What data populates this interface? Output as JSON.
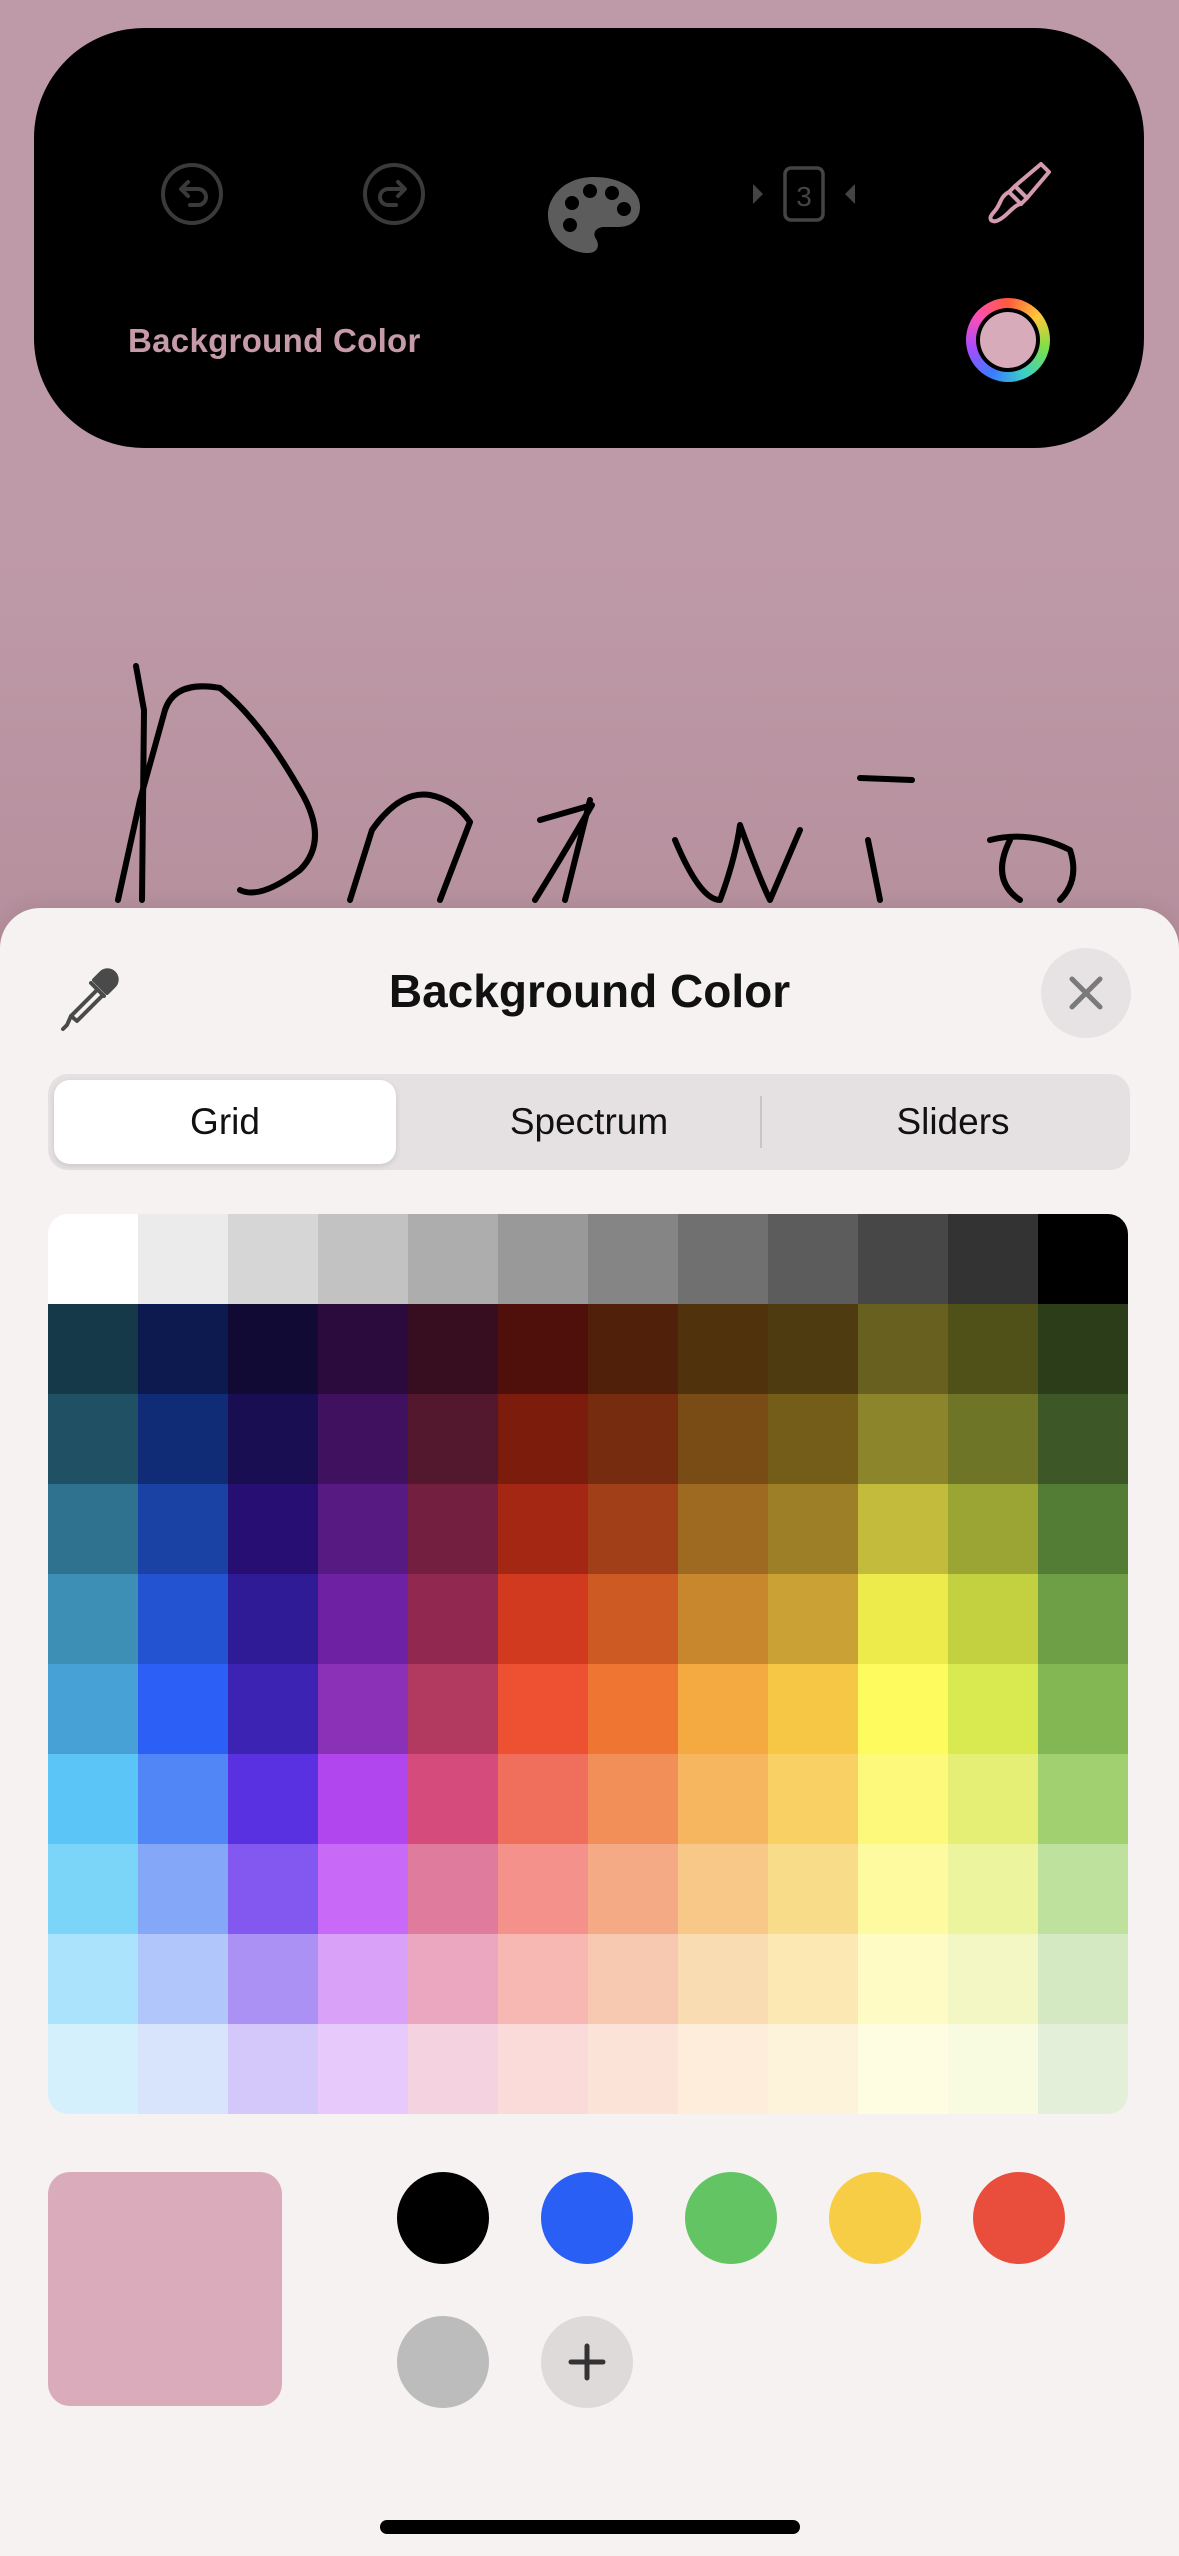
{
  "toolbar": {
    "label": "Background Color",
    "pages_count": "3",
    "icons": {
      "undo": "undo-icon",
      "redo": "redo-icon",
      "palette": "palette-icon",
      "pages": "page-stepper-icon",
      "brush": "brush-icon",
      "color_ring": "color-ring-icon"
    },
    "current_color": "#d8abbb"
  },
  "sheet": {
    "title": "Background Color",
    "eyedropper_icon": "eyedropper-icon",
    "close_icon": "close-icon",
    "tabs": [
      {
        "label": "Grid",
        "selected": true
      },
      {
        "label": "Spectrum",
        "selected": false
      },
      {
        "label": "Sliders",
        "selected": false
      }
    ],
    "grid_colors": [
      [
        "#ffffff",
        "#ebebeb",
        "#d6d6d6",
        "#c2c2c2",
        "#adadad",
        "#999999",
        "#858585",
        "#707070",
        "#5c5c5c",
        "#474747",
        "#333333",
        "#000000"
      ],
      [
        "#16394a",
        "#0c1a4f",
        "#110a35",
        "#2b0b3e",
        "#370e1f",
        "#4f0f0a",
        "#51200b",
        "#50320c",
        "#4e3b10",
        "#67601e",
        "#4f5119",
        "#2b3e19"
      ],
      [
        "#1f5064",
        "#102c76",
        "#190e52",
        "#3f115e",
        "#53172e",
        "#7b1c0d",
        "#762d0f",
        "#784c14",
        "#745c19",
        "#8c852b",
        "#6e7526",
        "#3d5826"
      ],
      [
        "#2e728f",
        "#1a41a4",
        "#260e72",
        "#571a82",
        "#721f40",
        "#a32713",
        "#a14018",
        "#9e6a21",
        "#9d7f27",
        "#c3bb3b",
        "#9aa533",
        "#537d35"
      ],
      [
        "#3d8fb5",
        "#2453d1",
        "#2f1b96",
        "#6e22a3",
        "#912850",
        "#d13a1f",
        "#cc5a22",
        "#c8862d",
        "#caa134",
        "#edea4b",
        "#c3d040",
        "#6e9e45"
      ],
      [
        "#48a1d6",
        "#2b5ff5",
        "#3d23b3",
        "#8a31b8",
        "#b23a60",
        "#ee5131",
        "#ef7532",
        "#f4a941",
        "#f6c744",
        "#fdfb5e",
        "#d9ea51",
        "#83b753"
      ],
      [
        "#5bc5f8",
        "#5186f7",
        "#5a31e1",
        "#b146ee",
        "#d54c7c",
        "#f06f5c",
        "#f28f58",
        "#f5b65f",
        "#f8d063",
        "#fdf97b",
        "#e5ef76",
        "#a1d071"
      ],
      [
        "#7ad5f9",
        "#84a7f8",
        "#8258f0",
        "#c969f7",
        "#df7b9d",
        "#f3918a",
        "#f5aa86",
        "#f7c888",
        "#f9dc89",
        "#fdfaa0",
        "#edf49e",
        "#bee19d"
      ],
      [
        "#aae3fb",
        "#b1c6fa",
        "#ac91f4",
        "#daa1f9",
        "#eba6c0",
        "#f7b8b4",
        "#f8c9b1",
        "#fadcb2",
        "#fbe8b3",
        "#fefbc4",
        "#f3f7c3",
        "#d4e9c1"
      ],
      [
        "#d5f0fd",
        "#d8e3fc",
        "#d4c7f9",
        "#e8c9fb",
        "#f5d2df",
        "#fadbd9",
        "#fbe3d8",
        "#fdedda",
        "#fdf3da",
        "#fefde2",
        "#f8fbe0",
        "#e3efd9"
      ]
    ],
    "current_color": "#d9abbb",
    "saved_swatches": [
      "#000000",
      "#2a5ff5",
      "#63c464",
      "#f7cd45",
      "#e94e3d",
      "#bcbcbc"
    ],
    "add_icon": "plus-icon"
  },
  "drawing": {
    "stroke_color": "#000000"
  }
}
